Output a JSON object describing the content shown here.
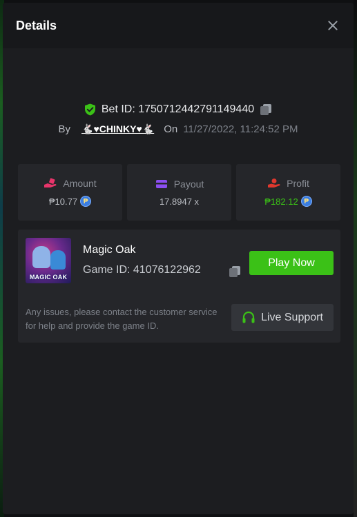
{
  "header": {
    "title": "Details"
  },
  "bet": {
    "id_label": "Bet ID: 1750712442791149440",
    "by_label": "By",
    "user": "🐇♥CHINKY♥🐇",
    "on_label": "On",
    "date": "11/27/2022, 11:24:52 PM"
  },
  "stats": {
    "amount": {
      "label": "Amount",
      "value": "₱10.77"
    },
    "payout": {
      "label": "Payout",
      "value": "17.8947 x"
    },
    "profit": {
      "label": "Profit",
      "value": "₱182.12"
    }
  },
  "coin_symbol": "₱",
  "game": {
    "thumb_title": "MAGIC OAK",
    "name": "Magic Oak",
    "id_label": "Game ID: 41076122962",
    "play_label": "Play Now",
    "support_text": "Any issues, please contact the customer service for help and provide the game ID.",
    "live_support_label": "Live Support"
  },
  "colors": {
    "accent_green": "#3bc117",
    "amount_icon": "#e8356b",
    "payout_icon": "#8b4ef0",
    "profit_icon": "#e0382e"
  },
  "icons": {
    "close": "close-icon",
    "shield": "shield-check-icon",
    "copy": "copy-icon",
    "amount": "bet-hand-icon",
    "payout": "wallet-card-icon",
    "profit": "profit-hand-icon",
    "headset": "headset-icon"
  }
}
